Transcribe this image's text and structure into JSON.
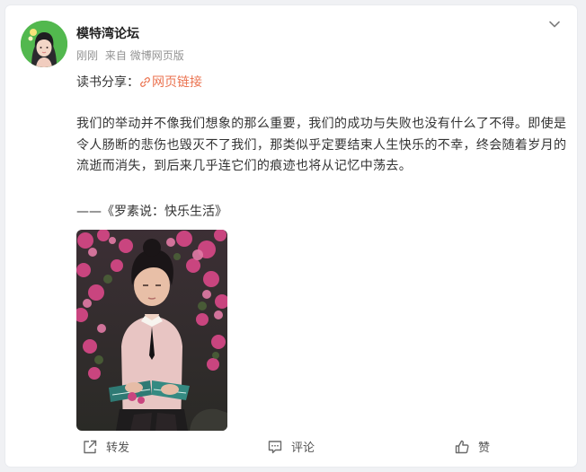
{
  "post": {
    "username": "模特湾论坛",
    "time": "刚刚",
    "source_prefix": "来自",
    "source_app": "微博网页版",
    "share_prefix": "读书分享：",
    "link_label": "网页链接",
    "body": "我们的举动并不像我们想象的那么重要，我们的成功与失败也没有什么了不得。即使是令人肠断的悲伤也毁灭不了我们，那类似乎定要结束人生快乐的不幸，终会随着岁月的流逝而消失，到后来几乎连它们的痕迹也将从记忆中荡去。",
    "quote_source": "——《罗素说：快乐生活》"
  },
  "actions": {
    "repost": "转发",
    "comment": "评论",
    "like": "赞"
  },
  "colors": {
    "link": "#eb7350",
    "meta": "#939393",
    "text": "#333333",
    "avatar_bg": "#4cb34a"
  },
  "icons": [
    "chevron-down-icon",
    "link-icon",
    "repost-icon",
    "comment-icon",
    "like-icon"
  ]
}
